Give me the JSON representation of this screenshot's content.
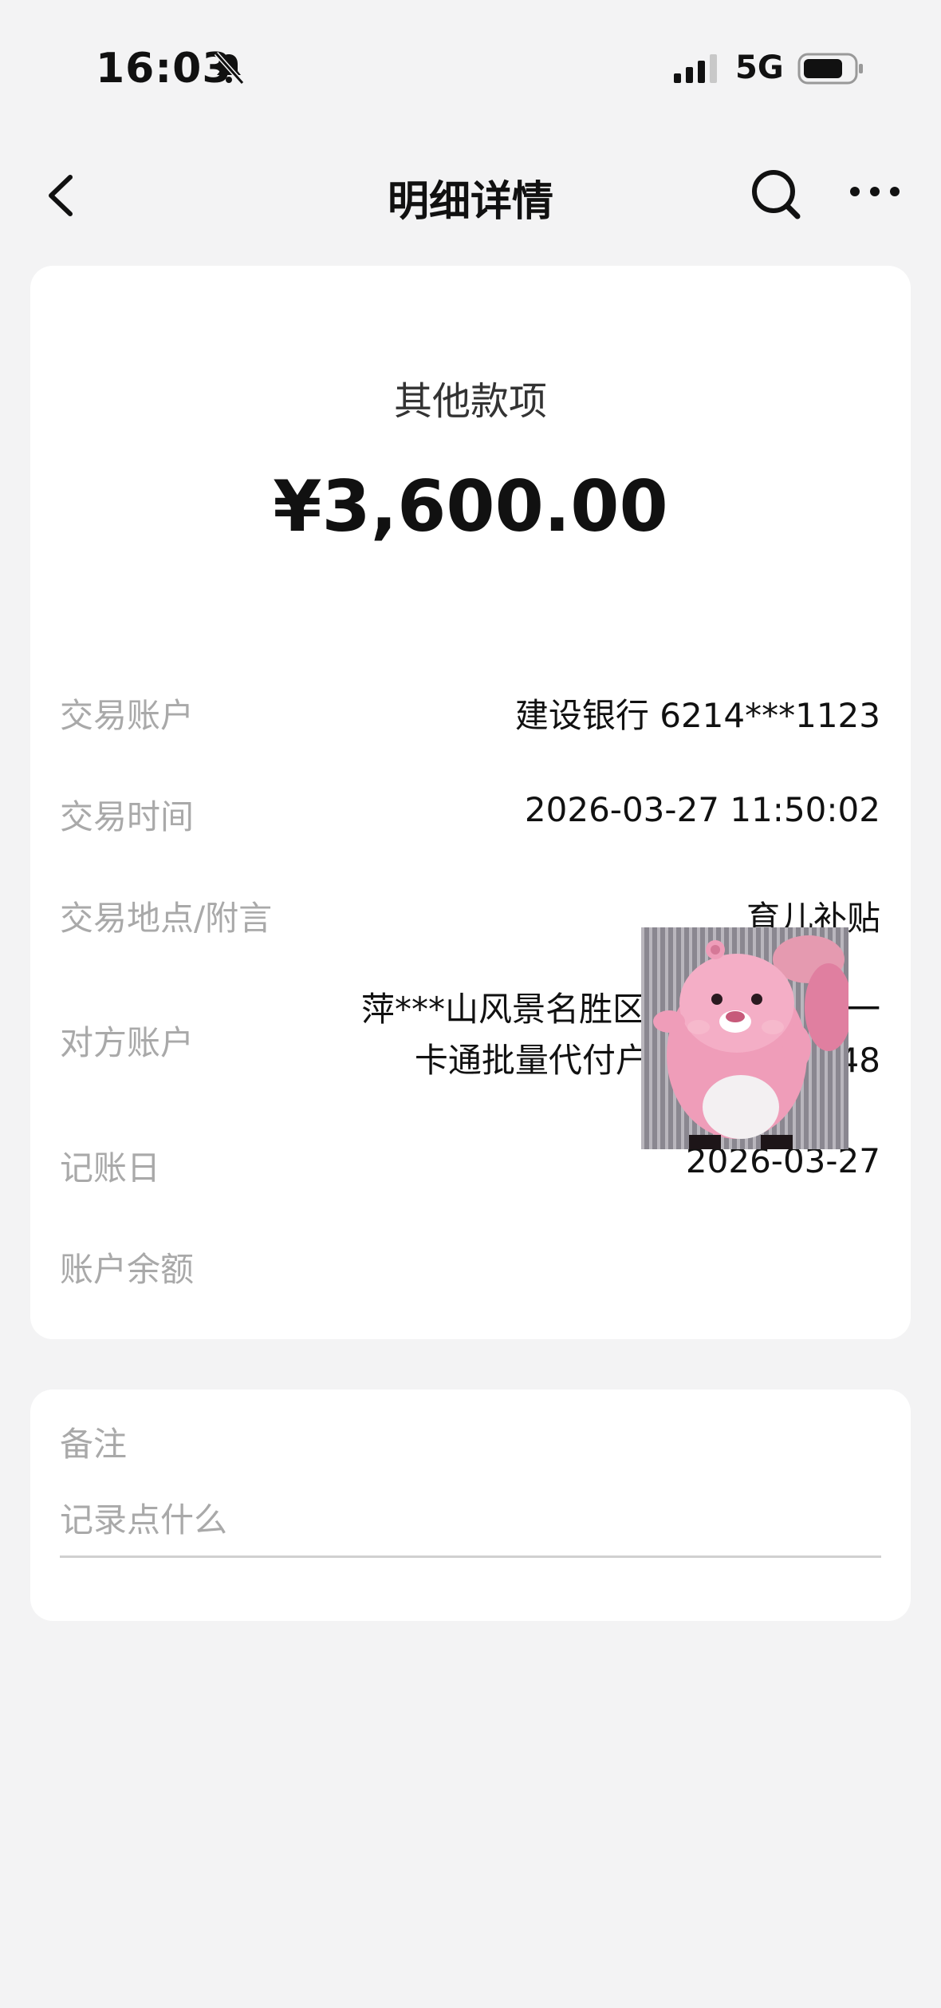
{
  "status_bar": {
    "time": "16:03",
    "network": "5G",
    "icons": [
      "bell-mute-icon",
      "signal-icon",
      "battery-icon"
    ]
  },
  "nav": {
    "title": "明细详情",
    "icons": [
      "back-chevron-icon",
      "search-icon",
      "more-dots-icon"
    ]
  },
  "transaction": {
    "category": "其他款项",
    "amount": "¥3,600.00",
    "rows": [
      {
        "label": "交易账户",
        "value": "建设银行 6214***1123"
      },
      {
        "label": "交易时间",
        "value": "2026-03-27 11:50:02"
      },
      {
        "label": "交易地点/附言",
        "value": "育儿补贴"
      },
      {
        "label": "对方账户",
        "value_line1": "萍***山风景名胜区公共服务中心一",
        "value_line2": "卡通批量代付户 1504***0448"
      },
      {
        "label": "记账日",
        "value": "2026-03-27"
      },
      {
        "label": "账户余额",
        "value": ""
      }
    ]
  },
  "note": {
    "label": "备注",
    "placeholder": "记录点什么"
  },
  "colors": {
    "background": "#f3f3f4",
    "card": "#ffffff",
    "label_gray": "#a9a9a9"
  }
}
